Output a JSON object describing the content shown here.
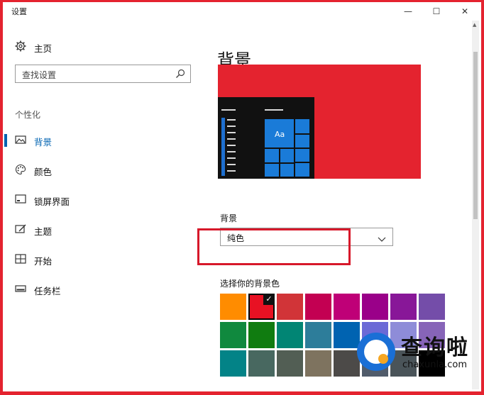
{
  "window": {
    "title": "设置",
    "minimize_glyph": "—",
    "maximize_glyph": "☐",
    "close_glyph": "✕"
  },
  "sidebar": {
    "home_label": "主页",
    "search_placeholder": "查找设置",
    "section_label": "个性化",
    "items": [
      {
        "label": "背景",
        "icon": "image-icon",
        "active": true
      },
      {
        "label": "颜色",
        "icon": "palette-icon",
        "active": false
      },
      {
        "label": "锁屏界面",
        "icon": "lockscreen-icon",
        "active": false
      },
      {
        "label": "主题",
        "icon": "theme-icon",
        "active": false
      },
      {
        "label": "开始",
        "icon": "start-icon",
        "active": false
      },
      {
        "label": "任务栏",
        "icon": "taskbar-icon",
        "active": false
      }
    ]
  },
  "main": {
    "title": "背景",
    "preview": {
      "tile_text": "Aa",
      "wallpaper_color": "#e4232f"
    },
    "background_label": "背景",
    "background_value": "纯色",
    "color_label": "选择你的背景色",
    "swatches": [
      [
        "#ff8c00",
        "#e81123",
        "#d13438",
        "#c30052",
        "#bf0077",
        "#9a0089",
        "#881798",
        "#744da9"
      ],
      [
        "#10893e",
        "#107c10",
        "#018574",
        "#2d7d9a",
        "#0063b1",
        "#6b69d6",
        "#8e8cd8",
        "#8764b8"
      ],
      [
        "#038387",
        "#486860",
        "#525e54",
        "#7e735f",
        "#4c4a48",
        "#515c6b",
        "#4a5459",
        "#000000"
      ]
    ],
    "selected_swatch": "1-row-0"
  },
  "watermark": {
    "text": "查询啦",
    "url": "chaxunla.com"
  },
  "colors": {
    "accent": "#0063b1",
    "frame": "#e4232f",
    "highlight_box": "#d7182a"
  }
}
